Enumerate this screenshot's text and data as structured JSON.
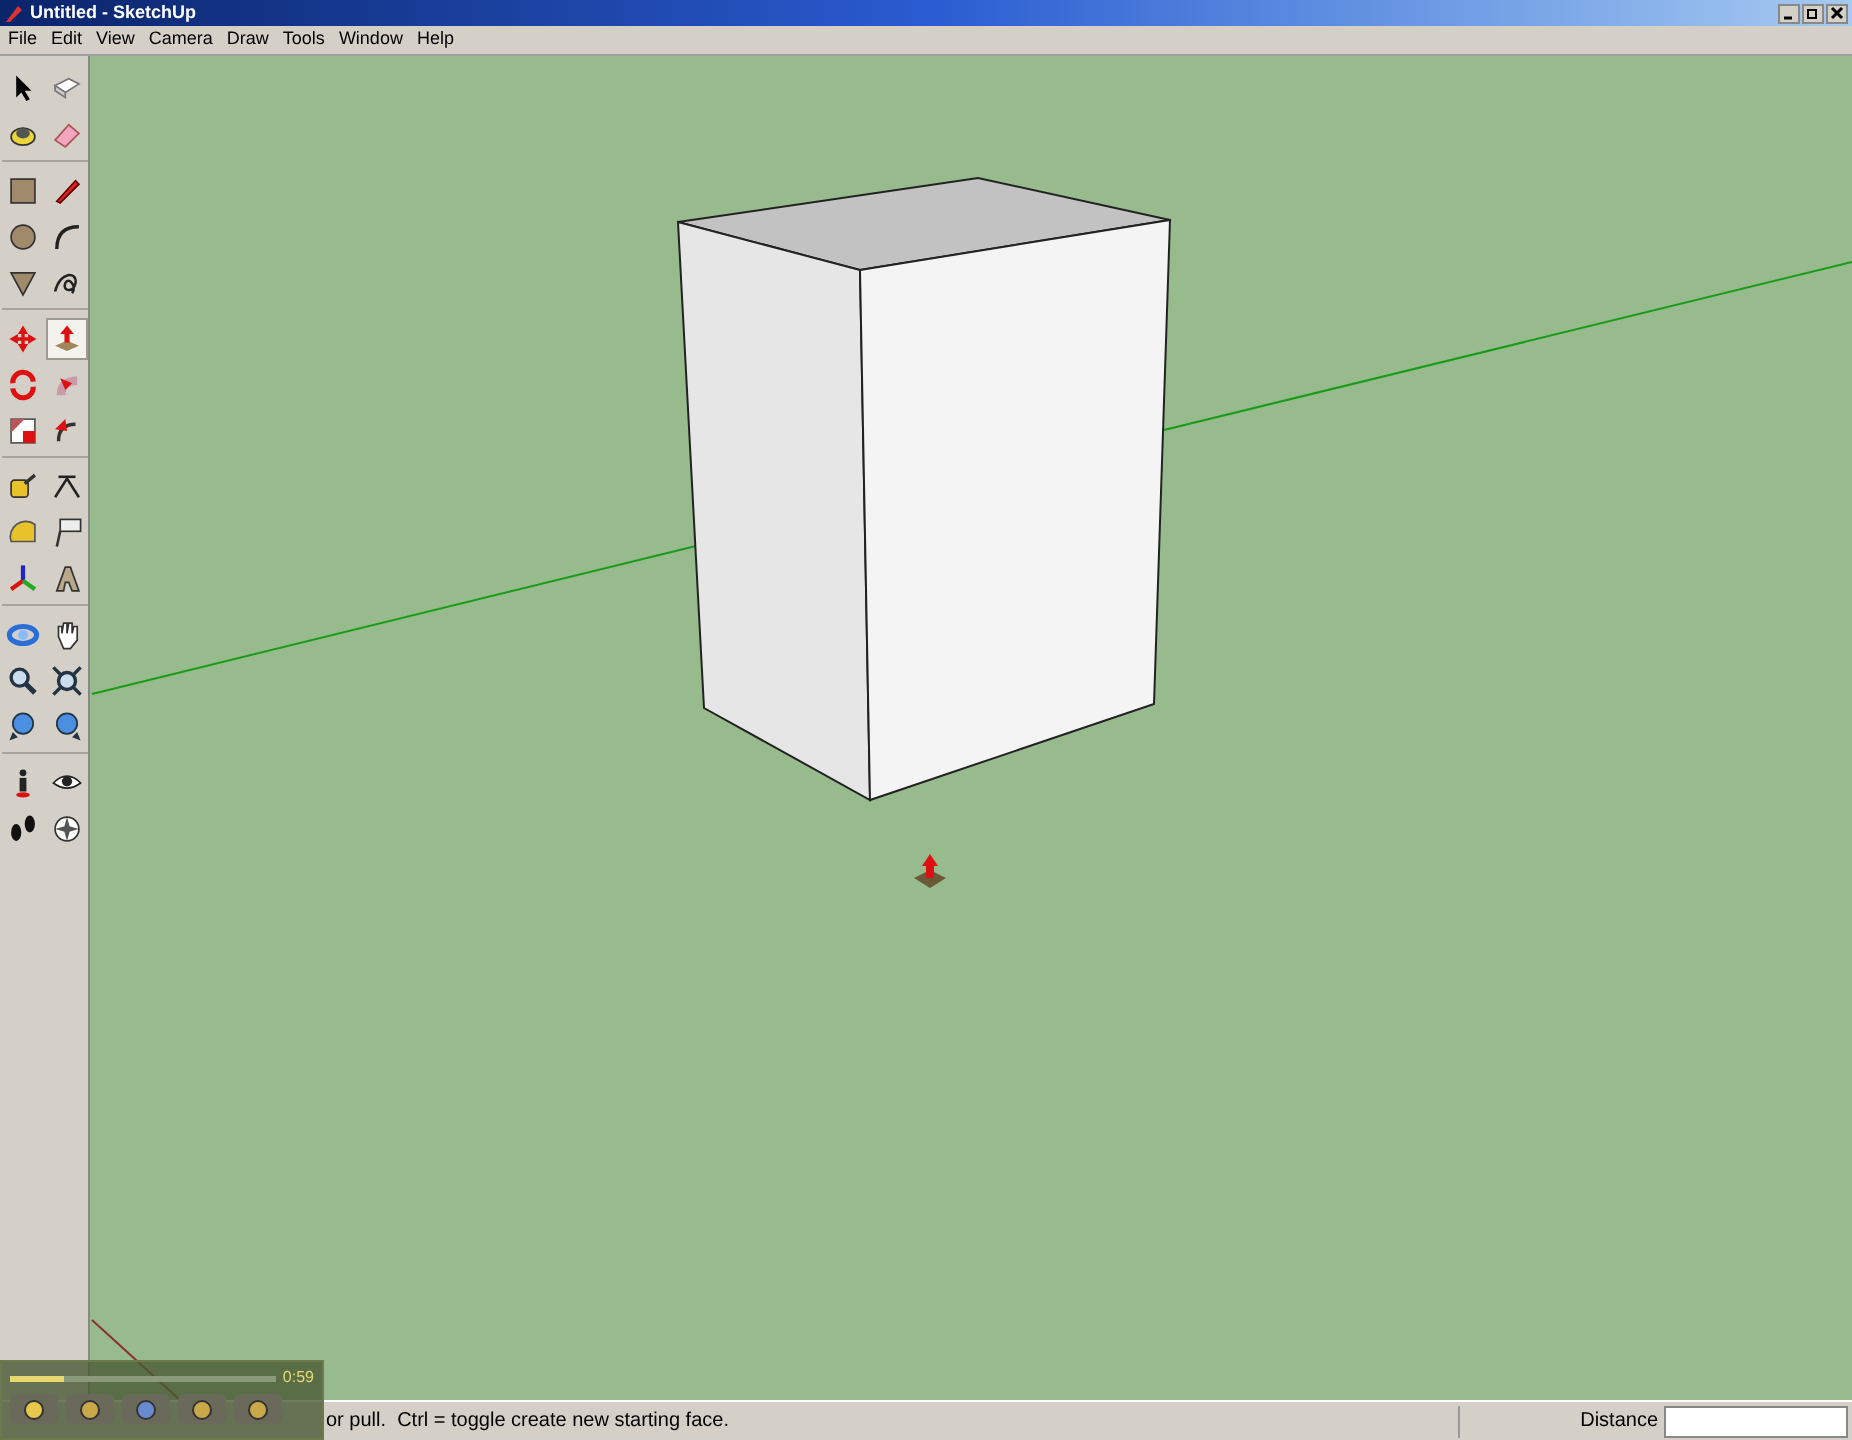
{
  "window": {
    "title": "Untitled - SketchUp"
  },
  "menu": [
    "File",
    "Edit",
    "View",
    "Camera",
    "Draw",
    "Tools",
    "Window",
    "Help"
  ],
  "toolbar": {
    "tools": [
      {
        "kind": "select",
        "selected": false
      },
      {
        "kind": "component",
        "selected": false
      },
      {
        "kind": "paint",
        "selected": false
      },
      {
        "kind": "eraser",
        "selected": false
      },
      {
        "kind": "rectangle",
        "selected": false
      },
      {
        "kind": "pencil",
        "selected": false
      },
      {
        "kind": "circle",
        "selected": false
      },
      {
        "kind": "arc",
        "selected": false
      },
      {
        "kind": "polygon",
        "selected": false
      },
      {
        "kind": "freehand",
        "selected": false
      },
      {
        "kind": "move",
        "selected": false
      },
      {
        "kind": "pushpull",
        "selected": true
      },
      {
        "kind": "rotate",
        "selected": false
      },
      {
        "kind": "followme",
        "selected": false
      },
      {
        "kind": "scale",
        "selected": false
      },
      {
        "kind": "offset",
        "selected": false
      },
      {
        "kind": "tape",
        "selected": false
      },
      {
        "kind": "dimension",
        "selected": false
      },
      {
        "kind": "protractor",
        "selected": false
      },
      {
        "kind": "text",
        "selected": false
      },
      {
        "kind": "axes",
        "selected": false
      },
      {
        "kind": "text3d",
        "selected": false
      },
      {
        "kind": "orbit",
        "selected": false
      },
      {
        "kind": "pan",
        "selected": false
      },
      {
        "kind": "zoom",
        "selected": false
      },
      {
        "kind": "zoomext",
        "selected": false
      },
      {
        "kind": "prev",
        "selected": false
      },
      {
        "kind": "next",
        "selected": false
      },
      {
        "kind": "camera",
        "selected": false
      },
      {
        "kind": "look",
        "selected": false
      },
      {
        "kind": "walk",
        "selected": false
      },
      {
        "kind": "compass",
        "selected": false
      }
    ]
  },
  "player": {
    "level": 0.2,
    "time": "0:59"
  },
  "status_bar": {
    "message": "or pull.  Ctrl = toggle create new starting face.",
    "measurement_label": "Distance"
  }
}
